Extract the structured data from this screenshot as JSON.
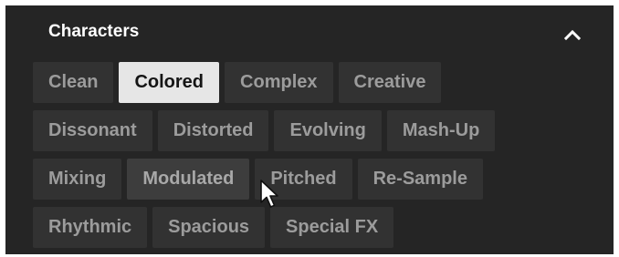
{
  "panel": {
    "title": "Characters",
    "collapse_icon": "chevron-up-icon"
  },
  "chips": {
    "rows": [
      [
        {
          "label": "Clean",
          "selected": false
        },
        {
          "label": "Colored",
          "selected": true
        },
        {
          "label": "Complex",
          "selected": false
        },
        {
          "label": "Creative",
          "selected": false
        }
      ],
      [
        {
          "label": "Dissonant",
          "selected": false
        },
        {
          "label": "Distorted",
          "selected": false
        },
        {
          "label": "Evolving",
          "selected": false
        },
        {
          "label": "Mash-Up",
          "selected": false
        }
      ],
      [
        {
          "label": "Mixing",
          "selected": false
        },
        {
          "label": "Modulated",
          "selected": false,
          "hovered": true
        },
        {
          "label": "Pitched",
          "selected": false
        },
        {
          "label": "Re-Sample",
          "selected": false
        }
      ],
      [
        {
          "label": "Rhythmic",
          "selected": false
        },
        {
          "label": "Spacious",
          "selected": false
        },
        {
          "label": "Special FX",
          "selected": false
        }
      ]
    ]
  },
  "colors": {
    "panel_bg": "#252525",
    "chip_bg": "#323232",
    "chip_text": "#9c9c9c",
    "selected_bg": "#e6e6e6",
    "selected_text": "#151515"
  }
}
